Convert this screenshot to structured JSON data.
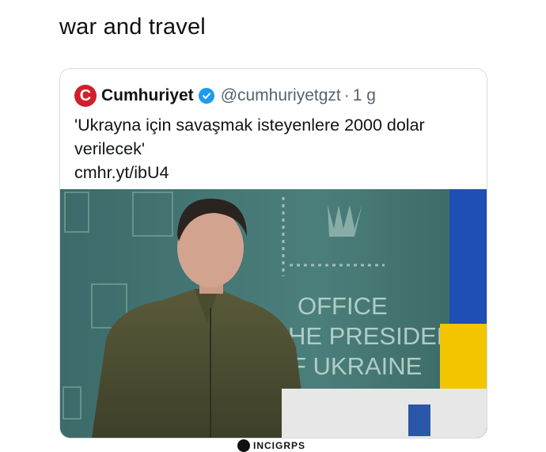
{
  "post": {
    "caption": "war and travel"
  },
  "tweet": {
    "avatar_letter": "C",
    "display_name": "Cumhuriyet",
    "handle": "@cumhuriyetgzt",
    "separator": "·",
    "time": "1 g",
    "text": "'Ukrayna için savaşmak isteyenlere 2000 dolar verilecek'",
    "link": "cmhr.yt/ibU4",
    "photo_text": {
      "line1": "OFFICE",
      "line2": "HE PRESIDENT",
      "line3": "F UKRAINE"
    }
  },
  "watermark": {
    "label": "INCIGRPS"
  },
  "colors": {
    "avatar": "#d0202a",
    "verified": "#1d9bf0",
    "photo_bg": "#3e6f6d",
    "flag_blue": "#1f4fb5",
    "flag_yellow": "#f2c500"
  }
}
